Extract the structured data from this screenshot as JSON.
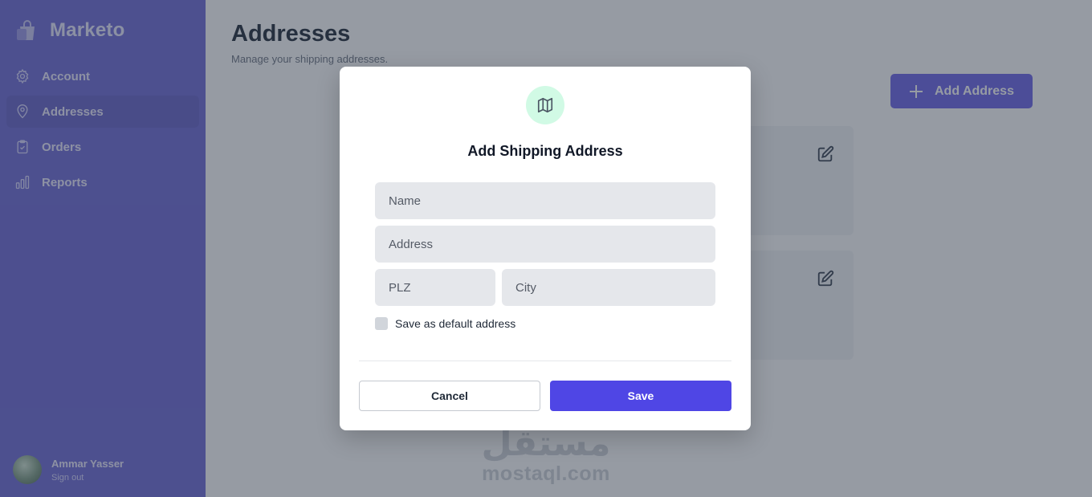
{
  "brand": {
    "name": "Marketo",
    "logo_icon": "shopping-bag-icon"
  },
  "nav": {
    "items": [
      {
        "label": "Account",
        "icon": "gear-icon",
        "active": false
      },
      {
        "label": "Addresses",
        "icon": "map-pin-icon",
        "active": true
      },
      {
        "label": "Orders",
        "icon": "clipboard-icon",
        "active": false
      },
      {
        "label": "Reports",
        "icon": "bar-chart-icon",
        "active": false
      }
    ]
  },
  "user": {
    "name": "Ammar Yasser",
    "signout_label": "Sign out"
  },
  "page": {
    "title": "Addresses",
    "subtitle": "Manage your shipping addresses.",
    "add_button_label": "Add Address"
  },
  "watermark": {
    "arabic": "مستقل",
    "latin": "mostaql.com"
  },
  "modal": {
    "icon": "map-icon",
    "title": "Add Shipping Address",
    "fields": {
      "name_placeholder": "Name",
      "address_placeholder": "Address",
      "plz_placeholder": "PLZ",
      "city_placeholder": "City"
    },
    "default_checkbox_label": "Save as default address",
    "cancel_label": "Cancel",
    "save_label": "Save"
  },
  "colors": {
    "sidebar": "#6d68d6",
    "primary": "#4f46e5",
    "icon_bg": "#d1fae5"
  }
}
